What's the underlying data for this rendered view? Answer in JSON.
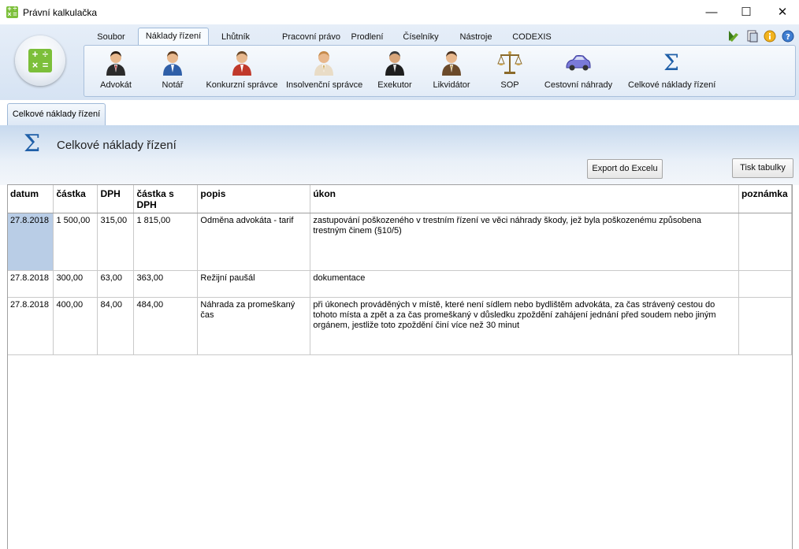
{
  "window": {
    "title": "Právní kalkulačka",
    "controls": {
      "minimize": "—",
      "maximize": "☐",
      "close": "✕"
    }
  },
  "ribbon": {
    "tabs": [
      {
        "label": "Soubor",
        "active": false
      },
      {
        "label": "Náklady řízení",
        "active": true
      },
      {
        "label": "Lhůtník",
        "active": false
      },
      {
        "label": "Pracovní právo",
        "active": false
      },
      {
        "label": "Prodlení",
        "active": false
      },
      {
        "label": "Číselníky",
        "active": false
      },
      {
        "label": "Nástroje",
        "active": false
      },
      {
        "label": "CODEXIS",
        "active": false
      }
    ],
    "tools": [
      {
        "label": "Advokát",
        "icon": "person-lawyer-icon"
      },
      {
        "label": "Notář",
        "icon": "person-notary-icon"
      },
      {
        "label": "Konkurzní správce",
        "icon": "person-red-icon"
      },
      {
        "label": "Insolvenční správce",
        "icon": "person-beige-icon"
      },
      {
        "label": "Exekutor",
        "icon": "person-dark-icon"
      },
      {
        "label": "Likvidátor",
        "icon": "person-brown-icon"
      },
      {
        "label": "SOP",
        "icon": "scales-icon"
      },
      {
        "label": "Cestovní náhrady",
        "icon": "car-icon"
      },
      {
        "label": "Celkové náklady řízení",
        "icon": "sigma-icon"
      }
    ],
    "top_icons": [
      "edit-icon",
      "document-icon",
      "info-icon",
      "help-icon"
    ]
  },
  "document_tab": {
    "label": "Celkové náklady řízení"
  },
  "content": {
    "title": "Celkové náklady řízení",
    "export_button": "Export do Excelu",
    "print_button": "Tisk tabulky"
  },
  "table": {
    "columns": [
      "datum",
      "částka",
      "DPH",
      "částka s DPH",
      "popis",
      "úkon",
      "poznámka"
    ],
    "rows": [
      [
        "27.8.2018",
        "1 500,00",
        "315,00",
        "1 815,00",
        "Odměna advokáta - tarif",
        "zastupování poškozeného v trestním řízení ve věci náhrady škody, jež byla poškozenému způsobena trestným činem (§10/5)",
        ""
      ],
      [
        "27.8.2018",
        "300,00",
        "63,00",
        "363,00",
        "Režijní paušál",
        "dokumentace",
        ""
      ],
      [
        "27.8.2018",
        "400,00",
        "84,00",
        "484,00",
        "Náhrada za promeškaný čas",
        "při úkonech prováděných v místě, které není sídlem nebo bydlištěm advokáta, za čas strávený cestou do tohoto místa a zpět a za čas promeškaný v důsledku zpoždění zahájení jednání před soudem nebo jiným orgánem, jestliže toto zpoždění činí více než 30 minut",
        ""
      ]
    ]
  }
}
